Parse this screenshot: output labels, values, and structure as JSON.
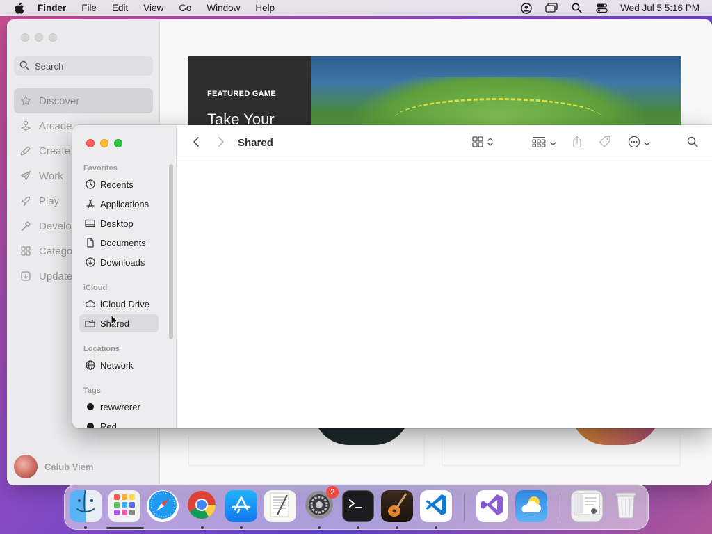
{
  "menubar": {
    "app_name": "Finder",
    "menus": [
      "File",
      "Edit",
      "View",
      "Go",
      "Window",
      "Help"
    ],
    "clock": "Wed Jul 5  5:16 PM"
  },
  "appstore": {
    "search_placeholder": "Search",
    "nav": [
      {
        "label": "Discover",
        "icon": "star-icon"
      },
      {
        "label": "Arcade",
        "icon": "joystick-icon"
      },
      {
        "label": "Create",
        "icon": "brush-icon"
      },
      {
        "label": "Work",
        "icon": "paper-plane-icon"
      },
      {
        "label": "Play",
        "icon": "rocket-icon"
      },
      {
        "label": "Develop",
        "icon": "hammer-icon"
      },
      {
        "label": "Categories",
        "icon": "grid-icon"
      },
      {
        "label": "Updates",
        "icon": "download-icon"
      }
    ],
    "user_name": "Calub Viem",
    "banner": {
      "label": "FEATURED GAME",
      "title": "Take Your"
    }
  },
  "finder": {
    "title": "Shared",
    "sections": {
      "favorites": "Favorites",
      "icloud": "iCloud",
      "locations": "Locations",
      "tags": "Tags"
    },
    "favorites": [
      {
        "label": "Recents",
        "icon": "clock-icon"
      },
      {
        "label": "Applications",
        "icon": "applications-icon"
      },
      {
        "label": "Desktop",
        "icon": "desktop-icon"
      },
      {
        "label": "Documents",
        "icon": "document-icon"
      },
      {
        "label": "Downloads",
        "icon": "download-icon"
      }
    ],
    "icloud": [
      {
        "label": "iCloud Drive",
        "icon": "cloud-icon"
      },
      {
        "label": "Shared",
        "icon": "shared-folder-icon",
        "selected": true
      }
    ],
    "locations": [
      {
        "label": "Network",
        "icon": "globe-icon"
      }
    ],
    "tags": [
      {
        "label": "rewwrerer",
        "color": "#1a1a1a"
      },
      {
        "label": "Red",
        "color": "#1a1a1a"
      }
    ]
  },
  "dock": {
    "apps": [
      "Finder",
      "Launchpad",
      "Safari",
      "Chrome",
      "App Store",
      "TextEdit",
      "System Settings",
      "Terminal",
      "GarageBand",
      "Visual Studio Code",
      "Visual Studio",
      "Weather",
      "Screenshot",
      "Trash"
    ],
    "settings_badge": "2"
  }
}
